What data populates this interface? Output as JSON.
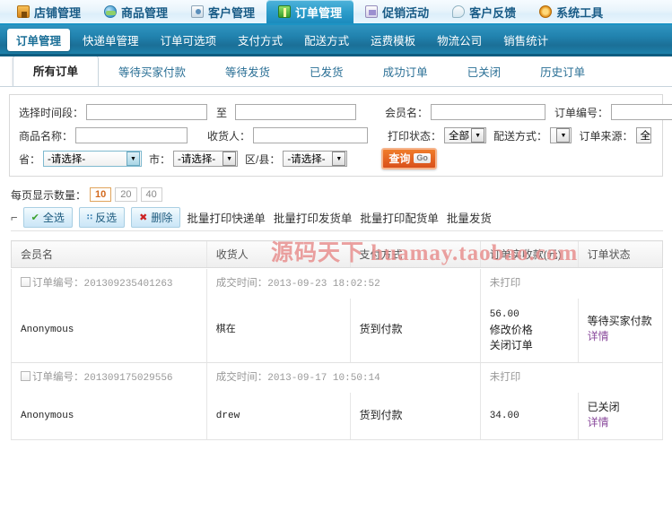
{
  "topnav": {
    "items": [
      {
        "label": "店铺管理",
        "icon": "shop-icon",
        "active": false
      },
      {
        "label": "商品管理",
        "icon": "goods-icon",
        "active": false
      },
      {
        "label": "客户管理",
        "icon": "customer-icon",
        "active": false
      },
      {
        "label": "订单管理",
        "icon": "order-icon",
        "active": true
      },
      {
        "label": "促销活动",
        "icon": "promotion-icon",
        "active": false
      },
      {
        "label": "客户反馈",
        "icon": "feedback-icon",
        "active": false
      },
      {
        "label": "系统工具",
        "icon": "tools-icon",
        "active": false
      }
    ]
  },
  "subnav": {
    "items": [
      {
        "label": "订单管理",
        "active": true
      },
      {
        "label": "快递单管理",
        "active": false
      },
      {
        "label": "订单可选项",
        "active": false
      },
      {
        "label": "支付方式",
        "active": false
      },
      {
        "label": "配送方式",
        "active": false
      },
      {
        "label": "运费模板",
        "active": false
      },
      {
        "label": "物流公司",
        "active": false
      },
      {
        "label": "销售统计",
        "active": false
      }
    ]
  },
  "tabs": {
    "items": [
      {
        "label": "所有订单",
        "active": true
      },
      {
        "label": "等待买家付款",
        "active": false
      },
      {
        "label": "等待发货",
        "active": false
      },
      {
        "label": "已发货",
        "active": false
      },
      {
        "label": "成功订单",
        "active": false
      },
      {
        "label": "已关闭",
        "active": false
      },
      {
        "label": "历史订单",
        "active": false
      }
    ]
  },
  "filter": {
    "time_label": "选择时间段：",
    "time_from_value": "",
    "time_to_label": "至",
    "time_to_value": "",
    "member_label": "会员名：",
    "member_value": "",
    "order_no_label": "订单编号：",
    "order_no_value": "",
    "product_label": "商品名称：",
    "product_value": "",
    "receiver_label": "收货人：",
    "receiver_value": "",
    "print_state_label": "打印状态：",
    "print_state_value": "全部",
    "ship_method_label": "配送方式：",
    "ship_method_value": "",
    "order_source_label": "订单来源：",
    "order_source_value": "全",
    "province_label": "省：",
    "province_value": "-请选择-",
    "city_label": "市：",
    "city_value": "-请选择-",
    "district_label": "区/县：",
    "district_value": "-请选择-",
    "search_button": "查询",
    "search_badge": "Go"
  },
  "pagesize": {
    "label": "每页显示数量：",
    "options": [
      "10",
      "20",
      "40"
    ],
    "selected": "10"
  },
  "toolbar": {
    "select_all": "全选",
    "invert": "反选",
    "delete": "删除",
    "links": [
      "批量打印快递单",
      "批量打印发货单",
      "批量打印配货单",
      "批量发货"
    ]
  },
  "watermark": {
    "cn": "源码天下",
    "en": "huamay.taobao.com"
  },
  "table": {
    "headers": [
      "会员名",
      "收货人",
      "支付方式",
      "订单实收款(元)",
      "订单状态"
    ],
    "order_no_label": "订单编号：",
    "deal_time_label": "成交时间：",
    "rows": [
      {
        "order_no": "201309235401263",
        "deal_time": "2013-09-23 18:02:52",
        "print_state": "未打印",
        "member": "Anonymous",
        "receiver": "棋在",
        "payment": "货到付款",
        "amount": "56.00",
        "actions": [
          "修改价格",
          "关闭订单"
        ],
        "status": "等待买家付款",
        "detail": "详情"
      },
      {
        "order_no": "201309175029556",
        "deal_time": "2013-09-17 10:50:14",
        "print_state": "未打印",
        "member": "Anonymous",
        "receiver": "drew",
        "payment": "货到付款",
        "amount": "34.00",
        "actions": [],
        "status": "已关闭",
        "detail": "详情"
      }
    ]
  }
}
